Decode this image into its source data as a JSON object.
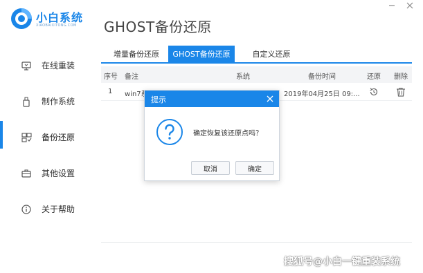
{
  "app": {
    "logo_title": "小白系统",
    "logo_subtitle": "XIAOBAIXITONG.COM",
    "brand_color": "#1a86e8"
  },
  "window_controls": [
    {
      "name": "minimize",
      "icon": "minimize-icon"
    },
    {
      "name": "close",
      "icon": "close-icon"
    }
  ],
  "sidebar": {
    "items": [
      {
        "label": "在线重装",
        "icon": "monitor-icon",
        "active": false
      },
      {
        "label": "制作系统",
        "icon": "usb-drive-icon",
        "active": false
      },
      {
        "label": "备份还原",
        "icon": "backup-icon",
        "active": true
      },
      {
        "label": "其他设置",
        "icon": "briefcase-icon",
        "active": false
      },
      {
        "label": "关于帮助",
        "icon": "info-icon",
        "active": false
      }
    ]
  },
  "page_title": "GHOST备份还原",
  "tabs": [
    {
      "label": "增量备份还原",
      "active": false
    },
    {
      "label": "GHOST备份还原",
      "active": true
    },
    {
      "label": "自定义还原",
      "active": false
    }
  ],
  "table": {
    "columns": [
      "序号",
      "备注",
      "系统",
      "备份时间",
      "还原",
      "删除"
    ],
    "rows": [
      {
        "index": "1",
        "note": "win7系",
        "system": "",
        "time": "2019年04月25日 09:...",
        "restore_icon": "restore-icon",
        "delete_icon": "trash-icon"
      }
    ]
  },
  "dialog": {
    "title": "提示",
    "message": "确定恢复该还原点吗？",
    "cancel_label": "取消",
    "ok_label": "确定",
    "icon": "question-icon"
  },
  "watermark": "搜狐号@小白一键重装系统"
}
